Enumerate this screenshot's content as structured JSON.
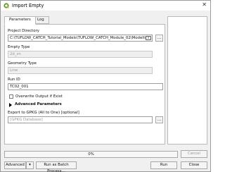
{
  "window": {
    "title": "Import Empty"
  },
  "tabs": [
    "Parameters",
    "Log"
  ],
  "fields": {
    "project_directory": {
      "label": "Project Directory",
      "value": "C:\\TUFLOW_CATCH_Tutorial_Models\\TUFLOW_CATCH_Module_02\\Modelling"
    },
    "empty_type": {
      "label": "Empty Type",
      "value": "2d_zn"
    },
    "geometry_type": {
      "label": "Geometry Type",
      "value": "Line"
    },
    "run_id": {
      "label": "Run ID",
      "value": "TC02_001"
    },
    "overwrite": {
      "label": "Overwrite Output if Exist",
      "checked": false
    },
    "advanced": {
      "label": "Advanced Parameters"
    },
    "export": {
      "label": "Export to GPKG (All to One) [optional]",
      "placeholder": "[GPKG Database]"
    }
  },
  "progress": {
    "text": "0%",
    "value": 0
  },
  "buttons": {
    "cancel": "Cancel",
    "advanced": "Advanced",
    "batch": "Run as Batch Process…",
    "run": "Run",
    "close": "Close",
    "browse": "…",
    "dropdown": "▾"
  }
}
